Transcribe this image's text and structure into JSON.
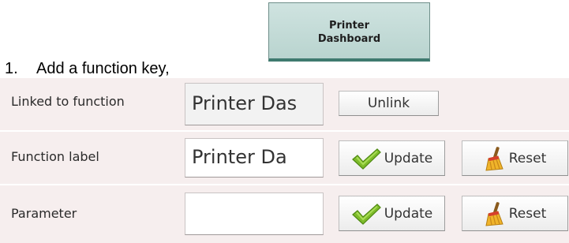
{
  "instruction": {
    "number": "1.",
    "text": "Add a function key,"
  },
  "function_key": {
    "line1": "Printer",
    "line2": "Dashboard"
  },
  "rows": [
    {
      "label": "Linked to function",
      "value": "Printer Das",
      "buttons": {
        "unlink": "Unlink"
      }
    },
    {
      "label": "Function label",
      "value": "Printer Da",
      "buttons": {
        "update": "Update",
        "reset": "Reset"
      }
    },
    {
      "label": "Parameter",
      "value": "",
      "buttons": {
        "update": "Update",
        "reset": "Reset"
      }
    }
  ],
  "icons": {
    "update": "checkmark-icon",
    "reset": "broom-icon"
  },
  "colors": {
    "row_background": "#f6eeee",
    "function_key_background": "#c4dbd7",
    "function_key_accent": "#3f7a6f",
    "checkmark_green": "#7dbb2a"
  }
}
